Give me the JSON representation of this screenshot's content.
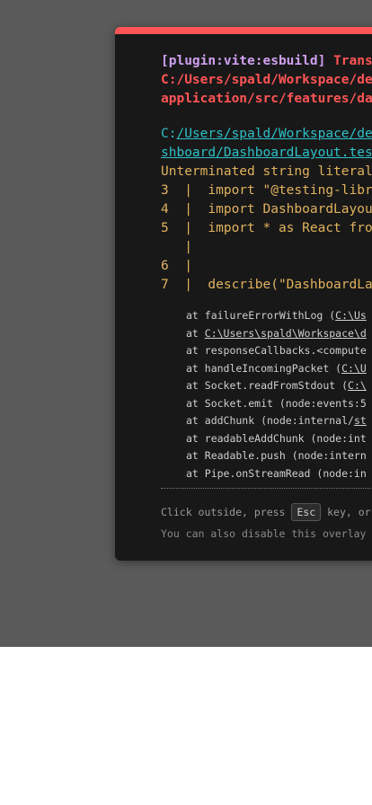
{
  "overlay": {
    "plugin": "[plugin:vite:esbuild]",
    "message_fragment": "Trans",
    "message_lines": [
      "C:/Users/spald/Workspace/de",
      "application/src/features/da"
    ],
    "file_prefix": "C:",
    "file_link": "/Users/spald/Workspace/de",
    "file_link_line2": "shboard/DashboardLayout.tes",
    "error": "Unterminated string literal",
    "frame_lines": [
      "3  |  import \"@testing-libr",
      "4  |  import DashboardLayou",
      "5  |  import * as React fro",
      "   |",
      "6  |",
      "7  |  describe(\"DashboardLa"
    ],
    "stack": [
      {
        "pre": "at failureErrorWithLog (",
        "link": "C:\\Us",
        "post": ""
      },
      {
        "pre": "at ",
        "link": "C:\\Users\\spald\\Workspace\\d",
        "post": ""
      },
      {
        "pre": "at responseCallbacks.<compute",
        "link": "",
        "post": ""
      },
      {
        "pre": "at handleIncomingPacket (",
        "link": "C:\\U",
        "post": ""
      },
      {
        "pre": "at Socket.readFromStdout (",
        "link": "C:\\",
        "post": ""
      },
      {
        "pre": "at Socket.emit (node:events:5",
        "link": "",
        "post": ""
      },
      {
        "pre": "at addChunk (node:internal/",
        "link": "st",
        "post": ""
      },
      {
        "pre": "at readableAddChunk (node:int",
        "link": "",
        "post": ""
      },
      {
        "pre": "at Readable.push (node:intern",
        "link": "",
        "post": ""
      },
      {
        "pre": "at Pipe.onStreamRead (node:in",
        "link": "",
        "post": ""
      }
    ],
    "tip_pre": "Click outside, press ",
    "tip_key": "Esc",
    "tip_post": " key, or",
    "tip2": "You can also disable this overlay"
  }
}
